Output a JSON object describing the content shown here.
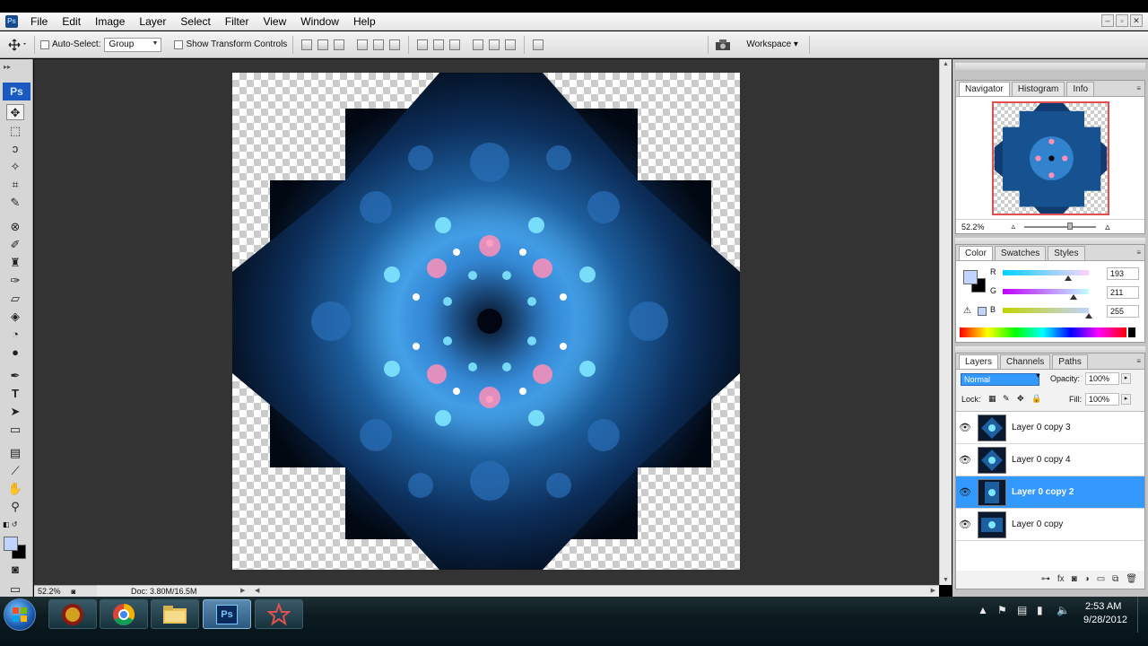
{
  "app": {
    "logo_small": "Ps",
    "badge": "Ps"
  },
  "menu": [
    "File",
    "Edit",
    "Image",
    "Layer",
    "Select",
    "Filter",
    "View",
    "Window",
    "Help"
  ],
  "window_controls": [
    "–",
    "▫",
    "✕"
  ],
  "options": {
    "auto_select_label": "Auto-Select:",
    "auto_select_value": "Group",
    "show_transform_label": "Show Transform Controls",
    "workspace_label": "Workspace ▾"
  },
  "status": {
    "zoom": "52.2%",
    "doc": "Doc: 3.80M/16.5M"
  },
  "navigator": {
    "tabs": [
      "Navigator",
      "Histogram",
      "Info"
    ],
    "zoom": "52.2%"
  },
  "color_panel": {
    "tabs": [
      "Color",
      "Swatches",
      "Styles"
    ],
    "channels": [
      {
        "label": "R",
        "value": "193",
        "level": 0.757
      },
      {
        "label": "G",
        "value": "211",
        "level": 0.827
      },
      {
        "label": "B",
        "value": "255",
        "level": 1.0
      }
    ],
    "foreground": "#c1d3ff"
  },
  "layers_panel": {
    "tabs": [
      "Layers",
      "Channels",
      "Paths"
    ],
    "blend_mode": "Normal",
    "opacity_label": "Opacity:",
    "opacity_value": "100%",
    "lock_label": "Lock:",
    "fill_label": "Fill:",
    "fill_value": "100%",
    "layers": [
      {
        "name": "Layer 0 copy 3",
        "selected": false
      },
      {
        "name": "Layer 0 copy 4",
        "selected": false
      },
      {
        "name": "Layer 0 copy 2",
        "selected": true
      },
      {
        "name": "Layer 0 copy",
        "selected": false
      }
    ],
    "footer_icons": [
      "link-icon",
      "fx-icon",
      "mask-icon",
      "adjustment-icon",
      "group-icon",
      "new-layer-icon",
      "trash-icon"
    ]
  },
  "taskbar": {
    "time": "2:53 AM",
    "date": "9/28/2012"
  },
  "colors": {
    "selection_blue": "#3399ff",
    "ps_blue": "#1a5ac0"
  }
}
